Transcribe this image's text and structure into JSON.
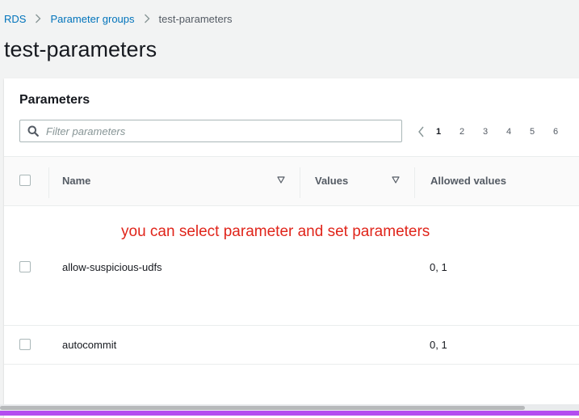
{
  "breadcrumb": {
    "items": [
      "RDS",
      "Parameter groups"
    ],
    "current": "test-parameters"
  },
  "page": {
    "title": "test-parameters"
  },
  "parameters": {
    "heading": "Parameters",
    "filter_placeholder": "Filter parameters",
    "pagination": {
      "pages": [
        "1",
        "2",
        "3",
        "4",
        "5",
        "6"
      ],
      "active": "1"
    },
    "columns": {
      "name": "Name",
      "values": "Values",
      "allowed_values": "Allowed values"
    },
    "rows": [
      {
        "name": "allow-suspicious-udfs",
        "values": "",
        "allowed_values": "0, 1"
      },
      {
        "name": "autocommit",
        "values": "",
        "allowed_values": "0, 1"
      }
    ]
  },
  "annotation": "you can select parameter and set parameters",
  "colors": {
    "link": "#0073bb",
    "annotation": "#e0251b",
    "bottom_bar": "#b44cf0"
  }
}
